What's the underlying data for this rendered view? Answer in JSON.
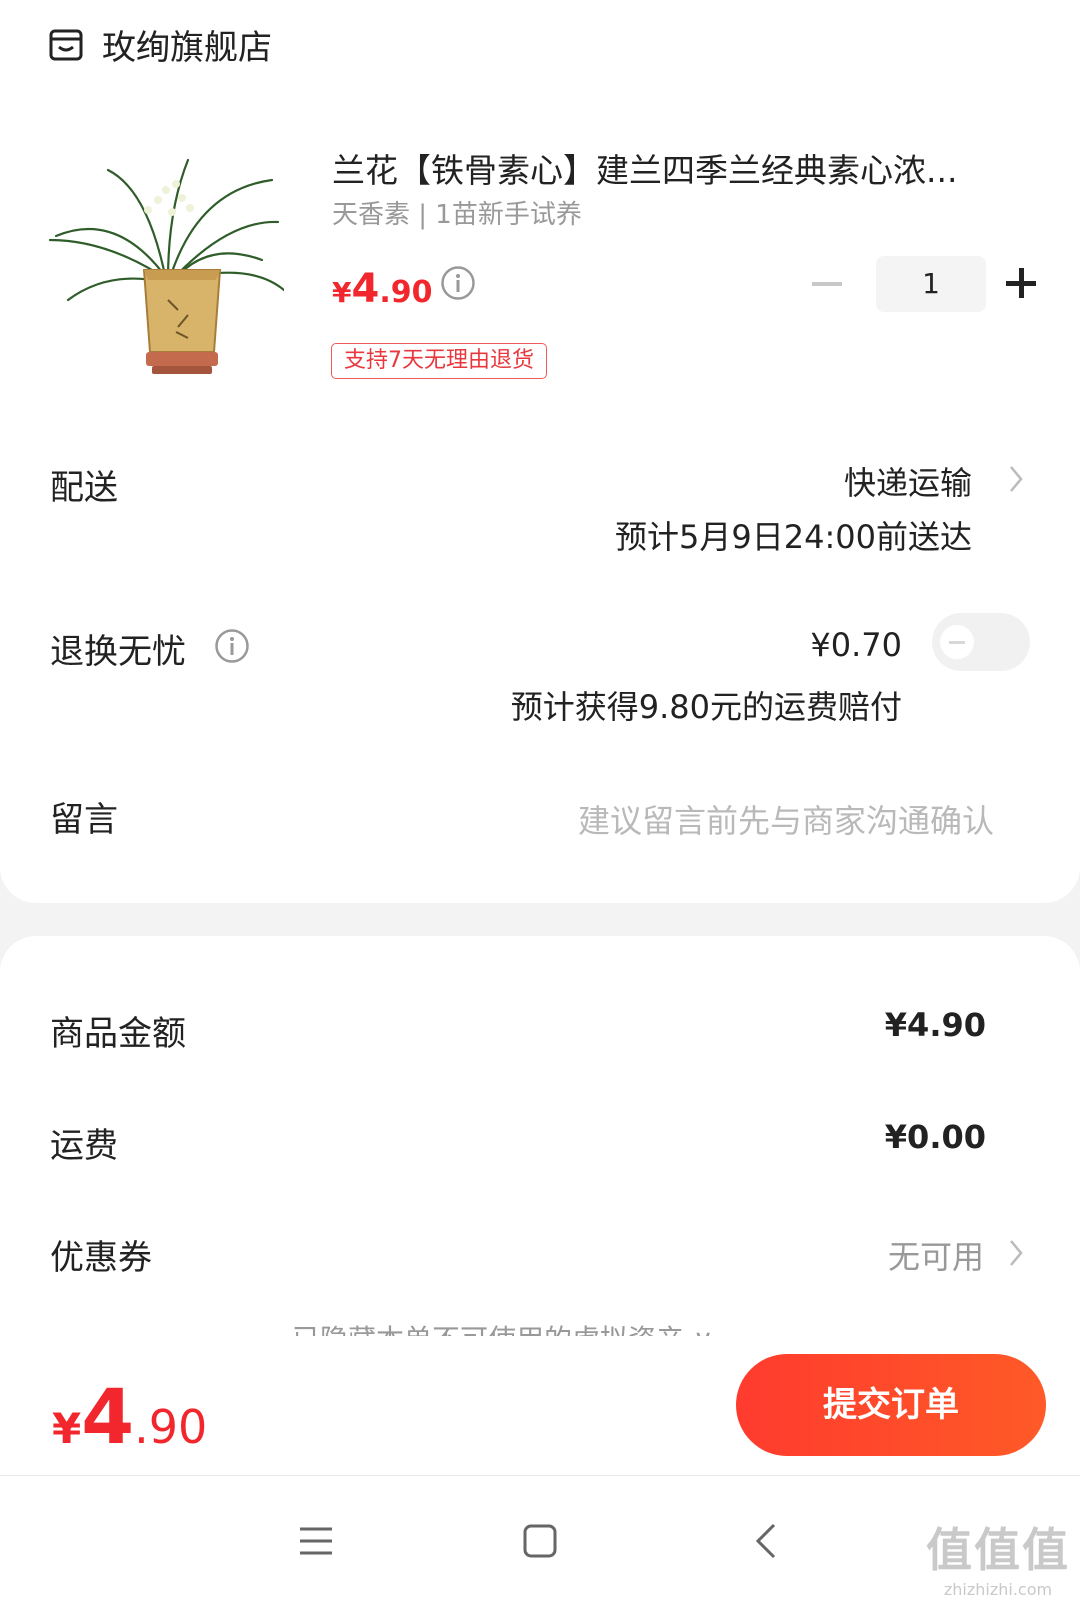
{
  "store": {
    "name": "玫绚旗舰店",
    "icon": "store-icon"
  },
  "product": {
    "title": "兰花【铁骨素心】建兰四季兰经典素心浓...",
    "spec": "天香素 | 1苗新手试养",
    "price_symbol": "¥",
    "price_int": "4",
    "price_dec": ".90",
    "badge": "支持7天无理由退货",
    "quantity": "1",
    "image": "orchid-plant-in-square-pot"
  },
  "delivery": {
    "label": "配送",
    "method": "快递运输",
    "eta": "预计5月9日24:00前送达"
  },
  "return_service": {
    "label": "退换无忧",
    "price": "¥0.70",
    "note": "预计获得9.80元的运费赔付",
    "enabled": false
  },
  "message": {
    "label": "留言",
    "placeholder": "建议留言前先与商家沟通确认"
  },
  "summary": {
    "goods_label": "商品金额",
    "goods_value": "¥4.90",
    "shipping_label": "运费",
    "shipping_value": "¥0.00",
    "coupon_label": "优惠券",
    "coupon_value": "无可用",
    "hidden_note": "已隐藏本单不可使用的虚拟资产 ∨"
  },
  "footer": {
    "total_symbol": "¥",
    "total_int": "4",
    "total_dec": ".90",
    "submit_label": "提交订单"
  },
  "watermark": {
    "big": "值值值",
    "small": "zhizhizhi.com"
  },
  "colors": {
    "accent": "#f2272d",
    "button": "#ff4a2a"
  }
}
